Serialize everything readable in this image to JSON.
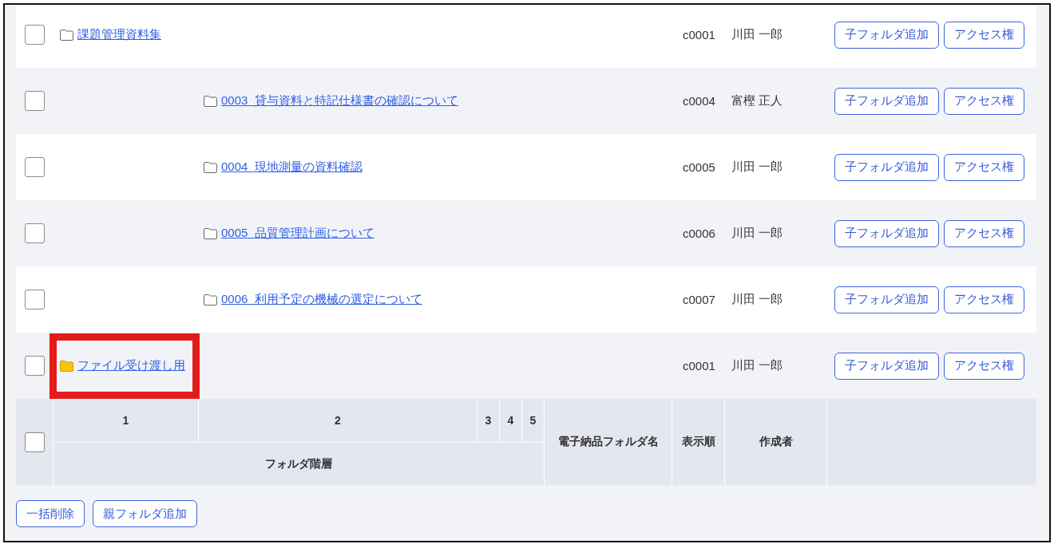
{
  "folders": [
    {
      "name": "課題管理資料集",
      "filled": false,
      "highlighted": false,
      "checked": false,
      "display_order": "c0001",
      "creator": "川田 一郎",
      "actions": [
        "子フォルダ追加",
        "アクセス権"
      ],
      "children": [
        {
          "name": "0003  貸与資料と特記仕様書の確認について",
          "filled": false,
          "highlighted": false,
          "checked": false,
          "display_order": "c0004",
          "creator": "富樫 正人",
          "actions": [
            "子フォルダ追加",
            "アクセス権"
          ]
        },
        {
          "name": "0004  現地測量の資料確認",
          "filled": false,
          "highlighted": false,
          "checked": false,
          "display_order": "c0005",
          "creator": "川田 一郎",
          "actions": [
            "子フォルダ追加",
            "アクセス権"
          ]
        },
        {
          "name": "0005  品質管理計画について",
          "filled": false,
          "highlighted": false,
          "checked": false,
          "display_order": "c0006",
          "creator": "川田 一郎",
          "actions": [
            "子フォルダ追加",
            "アクセス権"
          ]
        },
        {
          "name": "0006  利用予定の機械の選定について",
          "filled": false,
          "highlighted": false,
          "checked": false,
          "display_order": "c0007",
          "creator": "川田 一郎",
          "actions": [
            "子フォルダ追加",
            "アクセス権"
          ]
        }
      ]
    },
    {
      "name": "ファイル受け渡し用",
      "filled": true,
      "highlighted": true,
      "checked": false,
      "display_order": "c0001",
      "creator": "川田 一郎",
      "actions": [
        "子フォルダ追加",
        "アクセス権"
      ]
    }
  ],
  "table_header": {
    "checked": false,
    "levels": [
      "1",
      "2",
      "3",
      "4",
      "5"
    ],
    "hierarchy_label": "フォルダ階層",
    "columns": [
      "電子納品フォルダ名",
      "表示順",
      "作成者"
    ]
  },
  "buttons": [
    "一括削除",
    "親フォルダ追加"
  ]
}
